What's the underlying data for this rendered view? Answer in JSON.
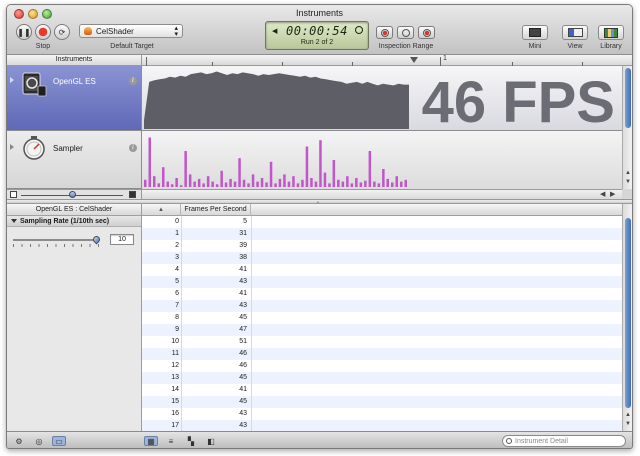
{
  "window": {
    "title": "Instruments"
  },
  "toolbar": {
    "stop_label": "Stop",
    "target_label": "Default Target",
    "target_value": "CelShader",
    "timer": "00:00:54",
    "run_label": "Run 2 of 2",
    "inspection_label": "Inspection Range",
    "mini_label": "Mini",
    "view_label": "View",
    "library_label": "Library"
  },
  "ruler": {
    "instruments_label": "Instruments",
    "tick_label": "1"
  },
  "tracks": [
    {
      "name": "OpenGL ES",
      "icon": "opengl-es-instrument-icon",
      "overlay_text": "46 FPS",
      "fill_color": "#5e5e66",
      "graph_values": [
        10,
        54,
        56,
        57,
        58,
        60,
        59,
        61,
        60,
        63,
        64,
        65,
        63,
        64,
        66,
        64,
        62,
        64,
        63,
        65,
        64,
        63,
        61,
        63,
        62,
        63,
        64,
        63,
        62,
        61,
        60,
        61,
        59,
        60,
        58,
        57,
        56,
        55,
        54,
        52,
        53,
        54,
        52,
        54,
        52,
        50,
        52,
        51,
        50,
        52,
        51,
        51
      ]
    },
    {
      "name": "Sampler",
      "icon": "sampler-instrument-icon",
      "fill_color": "#c056c8",
      "graph_values": [
        8,
        55,
        12,
        4,
        22,
        6,
        3,
        10,
        2,
        40,
        14,
        6,
        9,
        4,
        12,
        6,
        3,
        18,
        5,
        9,
        6,
        32,
        8,
        4,
        14,
        6,
        10,
        5,
        28,
        4,
        9,
        14,
        6,
        12,
        4,
        8,
        45,
        10,
        6,
        52,
        16,
        4,
        30,
        8,
        6,
        12,
        4,
        10,
        5,
        7,
        40,
        6,
        4,
        20,
        9,
        5,
        12,
        6,
        8
      ]
    }
  ],
  "detail": {
    "header": "OpenGL ES : CelShader",
    "section_label": "Sampling Rate (1/10th sec)",
    "sampling_rate": "10",
    "slider_level": 1.0
  },
  "table": {
    "columns": [
      "#",
      "Frames Per Second"
    ],
    "rows": [
      [
        "0",
        "5"
      ],
      [
        "1",
        "31"
      ],
      [
        "2",
        "39"
      ],
      [
        "3",
        "38"
      ],
      [
        "4",
        "41"
      ],
      [
        "5",
        "43"
      ],
      [
        "6",
        "41"
      ],
      [
        "7",
        "43"
      ],
      [
        "8",
        "45"
      ],
      [
        "9",
        "47"
      ],
      [
        "10",
        "51"
      ],
      [
        "11",
        "46"
      ],
      [
        "12",
        "46"
      ],
      [
        "13",
        "45"
      ],
      [
        "14",
        "41"
      ],
      [
        "15",
        "45"
      ],
      [
        "16",
        "43"
      ],
      [
        "17",
        "43"
      ]
    ]
  },
  "bottombar": {
    "search_placeholder": "Instrument Detail"
  }
}
